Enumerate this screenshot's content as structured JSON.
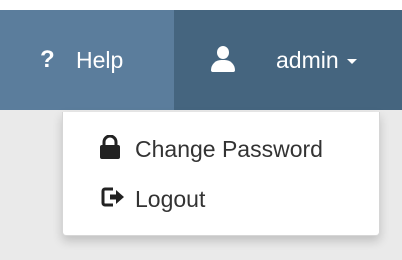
{
  "navbar": {
    "help": {
      "icon": "question-icon",
      "glyph": "?",
      "label": "Help"
    },
    "user": {
      "icon": "user-icon",
      "label": "admin",
      "caret_icon": "caret-down-icon"
    }
  },
  "dropdown": {
    "items": [
      {
        "icon": "lock-icon",
        "label": "Change Password"
      },
      {
        "icon": "logout-icon",
        "label": "Logout"
      }
    ]
  },
  "colors": {
    "navbar": "#4e7190",
    "help_bg": "#5b7d9c",
    "user_bg": "#45657f",
    "content_bg": "#eaeaea",
    "menu_text": "#333333"
  }
}
